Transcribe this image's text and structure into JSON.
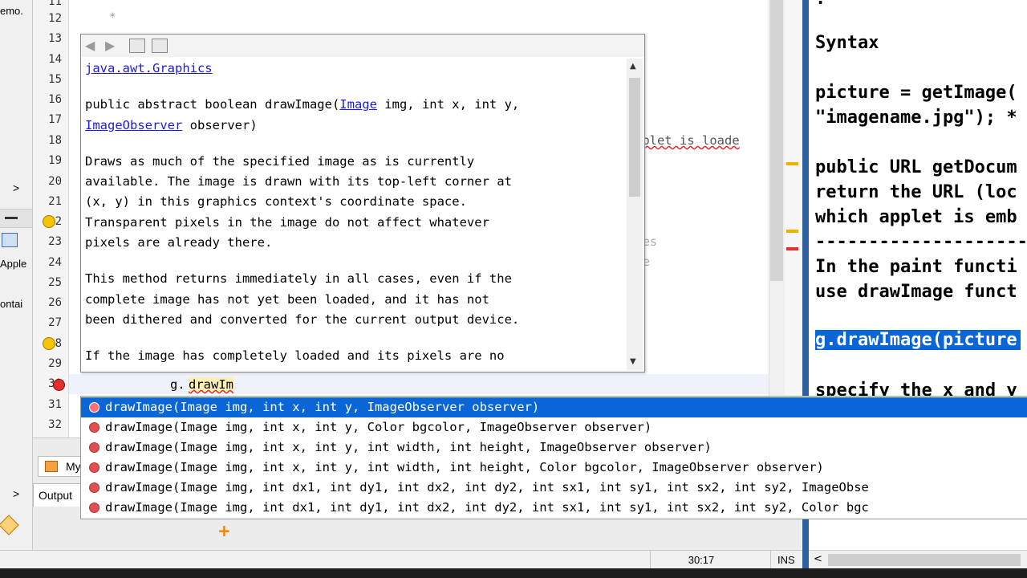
{
  "left_panel": {
    "fragments": [
      "emo.",
      "Apple",
      "ontai"
    ],
    "chevrons": [
      ">",
      ">"
    ]
  },
  "gutter": {
    "line_numbers": [
      "11",
      "12",
      "13",
      "14",
      "15",
      "16",
      "17",
      "18",
      "19",
      "20",
      "21",
      "22",
      "23",
      "24",
      "25",
      "26",
      "27",
      "28",
      "29",
      "30",
      "31",
      "32"
    ]
  },
  "editor": {
    "behind_fragments": [
      "pplet is loade",
      "es",
      "e"
    ],
    "current_line_code": "g.",
    "current_line_typed": "drawIm"
  },
  "javadoc": {
    "class_link": "java.awt.Graphics",
    "signature": {
      "prefix": "public abstract boolean drawImage(",
      "param1_type": "Image",
      "middle": " img, int x, int y,",
      "param2_type": "ImageObserver",
      "suffix": " observer)"
    },
    "paragraphs": [
      [
        "Draws as much of the specified image as is currently",
        "available. The image is drawn with its top-left corner at",
        "(x, y) in this graphics context's coordinate space.",
        "Transparent pixels in the image do not affect whatever",
        "pixels are already there."
      ],
      [
        "This method returns immediately in all cases, even if the",
        "complete image has not yet been loaded, and it has not",
        "been dithered and converted for the current output device."
      ],
      [
        "If the image has completely loaded and its pixels are no"
      ]
    ]
  },
  "completion": {
    "items": [
      {
        "name": "drawImage",
        "params": "(Image img, int x, int y, ImageObserver observer)",
        "selected": true
      },
      {
        "name": "drawImage",
        "params": "(Image img, int x, int y, Color bgcolor, ImageObserver observer)",
        "selected": false
      },
      {
        "name": "drawImage",
        "params": "(Image img, int x, int y, int width, int height, ImageObserver observer)",
        "selected": false
      },
      {
        "name": "drawImage",
        "params": "(Image img, int x, int y, int width, int height, Color bgcolor, ImageObserver observer)",
        "selected": false
      },
      {
        "name": "drawImage",
        "params": "(Image img, int dx1, int dy1, int dx2, int dy2, int sx1, int sy1, int sx2, int sy2, ImageObse",
        "selected": false
      },
      {
        "name": "drawImage",
        "params": "(Image img, int dx1, int dy1, int dx2, int dy2, int sx1, int sy1, int sx2, int sy2, Color bgc",
        "selected": false
      }
    ]
  },
  "bottom_panel": {
    "tab_fragment": "My",
    "output_tab": "Output"
  },
  "status_bar": {
    "position": "30:17",
    "mode": "INS"
  },
  "notes": {
    "lines": [
      "Syntax",
      "picture = getImage(",
      "\"imagename.jpg\"); *",
      "public URL getDocum",
      "return the URL (loc",
      "which applet is emb",
      "--------------------",
      "In the paint functi",
      "use drawImage funct",
      "g.drawImage(picture",
      "specify the x and y"
    ],
    "highlighted_line": "g.drawImage(picture"
  },
  "colors": {
    "selection": "#0a66d6",
    "link": "#1a1aee",
    "error_marker": "#e03030",
    "warning_marker": "#f0b000",
    "add_icon": "#f08000",
    "notes_divider": "#2e5fa0"
  }
}
